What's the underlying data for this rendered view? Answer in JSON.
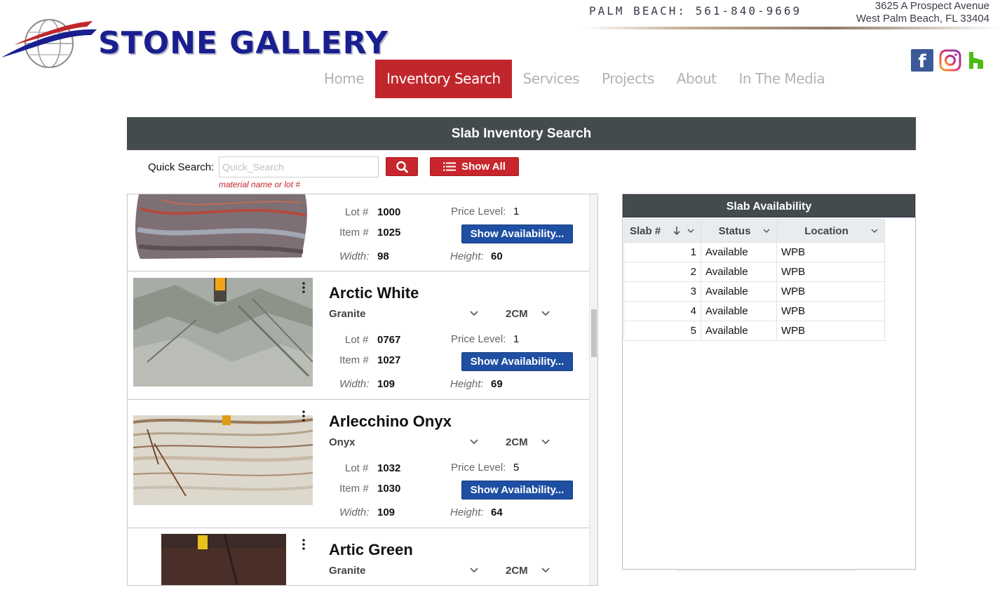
{
  "header": {
    "logo_text": "STONE GALLERY",
    "phone": "PALM BEACH: 561-840-9669",
    "address_line1": "3625 A Prospect Avenue",
    "address_line2": "West Palm Beach, FL 33404",
    "social": [
      "facebook-icon",
      "instagram-icon",
      "houzz-icon"
    ]
  },
  "nav": {
    "items": [
      {
        "label": "Home",
        "active": false
      },
      {
        "label": "Inventory Search",
        "active": true
      },
      {
        "label": "Services",
        "active": false
      },
      {
        "label": "Projects",
        "active": false
      },
      {
        "label": "About",
        "active": false
      },
      {
        "label": "In The Media",
        "active": false
      }
    ]
  },
  "search": {
    "title": "Slab Inventory Search",
    "label": "Quick Search:",
    "placeholder": "Quick_Search",
    "value": "",
    "hint": "material name or lot #",
    "show_all_label": "Show All"
  },
  "labels": {
    "lot": "Lot #",
    "item": "Item #",
    "price_level": "Price Level:",
    "width": "Width:",
    "height": "Height:",
    "show_availability": "Show Availability..."
  },
  "products": [
    {
      "name": "",
      "type": "",
      "thickness": "",
      "lot": "1000",
      "item": "1025",
      "price_level": "1",
      "width": "98",
      "height": "60"
    },
    {
      "name": "Arctic White",
      "type": "Granite",
      "thickness": "2CM",
      "lot": "0767",
      "item": "1027",
      "price_level": "1",
      "width": "109",
      "height": "69"
    },
    {
      "name": "Arlecchino Onyx",
      "type": "Onyx",
      "thickness": "2CM",
      "lot": "1032",
      "item": "1030",
      "price_level": "5",
      "width": "109",
      "height": "64"
    },
    {
      "name": "Artic Green",
      "type": "Granite",
      "thickness": "2CM",
      "lot": "",
      "item": "",
      "price_level": "",
      "width": "",
      "height": ""
    }
  ],
  "availability": {
    "title": "Slab Availability",
    "columns": [
      "Slab #",
      "Status",
      "Location"
    ],
    "rows": [
      {
        "slab": "1",
        "status": "Available",
        "location": "WPB"
      },
      {
        "slab": "2",
        "status": "Available",
        "location": "WPB"
      },
      {
        "slab": "3",
        "status": "Available",
        "location": "WPB"
      },
      {
        "slab": "4",
        "status": "Available",
        "location": "WPB"
      },
      {
        "slab": "5",
        "status": "Available",
        "location": "WPB"
      }
    ]
  },
  "colors": {
    "brand_red": "#c0272d",
    "header_dark": "#434b4c",
    "button_blue": "#1e4fa3",
    "logo_blue": "#1a1f8f"
  }
}
